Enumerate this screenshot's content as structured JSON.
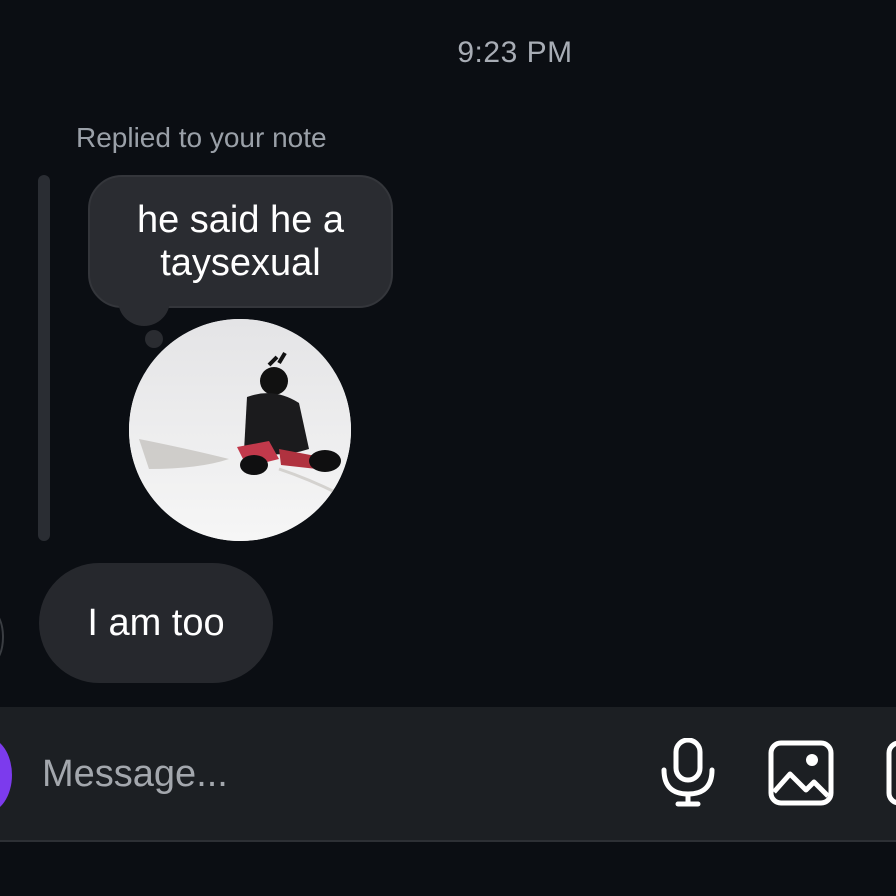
{
  "conversation": {
    "timestamp": "9:23 PM",
    "reply": {
      "label": "Replied to your note",
      "note_text": "he said he a taysexual"
    },
    "message": {
      "text": "I am too"
    }
  },
  "composer": {
    "placeholder": "Message...",
    "avatar_color": "#7c3bed",
    "icons": [
      "microphone-icon",
      "image-icon"
    ]
  },
  "colors": {
    "background": "#0b0e13",
    "bubble": "#26282d",
    "composer": "#1c1f23",
    "muted_text": "#a3a7ad"
  }
}
